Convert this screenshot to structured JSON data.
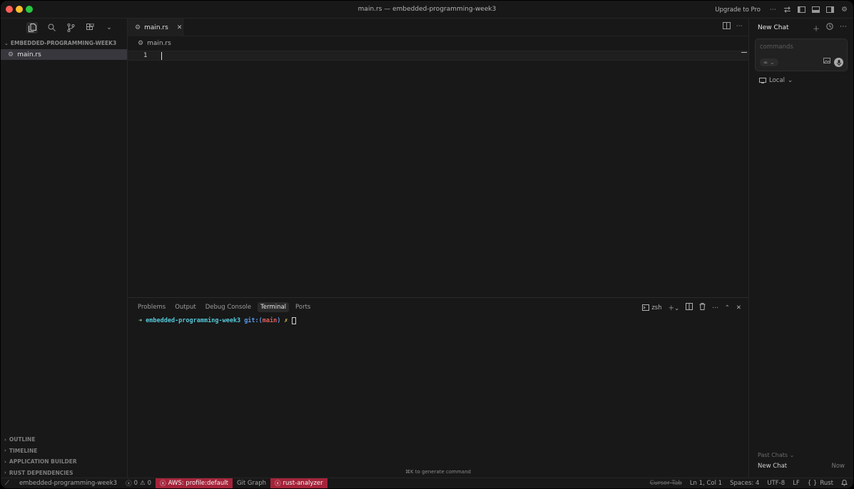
{
  "window": {
    "title": "main.rs — embedded-programming-week3"
  },
  "titlebar": {
    "upgrade_label": "Upgrade to Pro"
  },
  "explorer": {
    "folder_name": "EMBEDDED-PROGRAMMING-WEEK3",
    "files": [
      "main.rs"
    ],
    "sections": [
      "OUTLINE",
      "TIMELINE",
      "APPLICATION BUILDER",
      "RUST DEPENDENCIES"
    ]
  },
  "editor": {
    "tab_label": "main.rs",
    "breadcrumb": "main.rs",
    "line_number": "1"
  },
  "panel": {
    "tabs": [
      "Problems",
      "Output",
      "Debug Console",
      "Terminal",
      "Ports"
    ],
    "active_tab": "Terminal",
    "shell_label": "zsh",
    "terminal": {
      "arrow": "➜",
      "dir": "embedded-programming-week3",
      "git_prefix": "git:(",
      "branch": "main",
      "git_suffix": ")",
      "dirty_mark": "✗"
    },
    "generate_hint": "⌘K to generate command"
  },
  "chat": {
    "title": "New Chat",
    "input_placeholder": "commands",
    "model_label": "∞",
    "local_label": "Local",
    "past_chats_label": "Past Chats",
    "past_items": [
      {
        "name": "New Chat",
        "time": "Now"
      }
    ]
  },
  "statusbar": {
    "branch_label": "embedded-programming-week3",
    "errors": "0",
    "warnings": "0",
    "aws_label": "AWS: profile:default",
    "git_graph_label": "Git Graph",
    "rust_analyzer_label": "rust-analyzer",
    "cursor_tab_label": "Cursor Tab",
    "position": "Ln 1, Col 1",
    "spaces": "Spaces: 4",
    "encoding": "UTF-8",
    "eol": "LF",
    "language": "Rust",
    "language_prefix": "{ }"
  },
  "colors": {
    "error_badge": "#a5243a",
    "background": "#181818",
    "terminal_dir": "#55c8d8",
    "terminal_branch": "#e0605e"
  },
  "icons": [
    "explorer-icon",
    "search-icon",
    "source-control-icon",
    "extensions-icon",
    "split-editor-icon",
    "more-icon",
    "terminal-icon",
    "plus-icon",
    "trash-icon",
    "close-icon",
    "history-icon",
    "image-icon",
    "mic-icon",
    "bell-icon"
  ]
}
